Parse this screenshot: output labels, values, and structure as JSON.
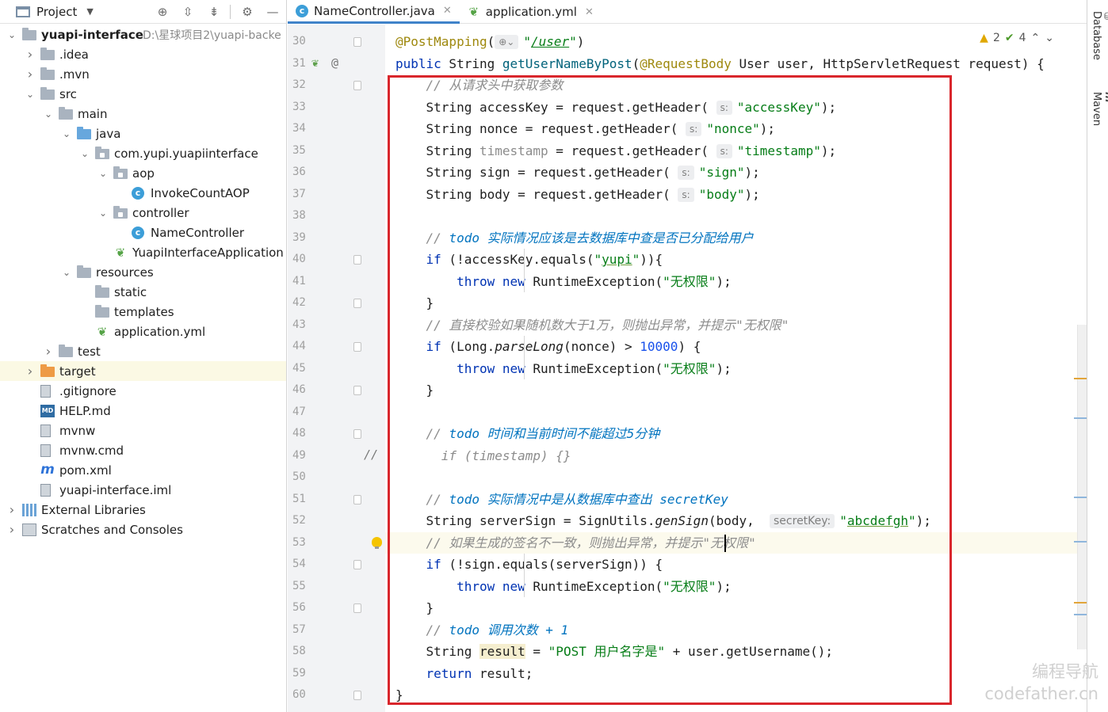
{
  "project_pane": {
    "title": "Project",
    "tree": [
      {
        "label": "yuapi-interface",
        "path": "D:\\星球项目2\\yuapi-backe",
        "indent": 0,
        "chevron": "open",
        "icon": "folder-module-icon"
      },
      {
        "label": ".idea",
        "indent": 1,
        "chevron": "closed",
        "icon": "folder-icon"
      },
      {
        "label": ".mvn",
        "indent": 1,
        "chevron": "closed",
        "icon": "folder-icon"
      },
      {
        "label": "src",
        "indent": 1,
        "chevron": "open",
        "icon": "folder-icon"
      },
      {
        "label": "main",
        "indent": 2,
        "chevron": "open",
        "icon": "folder-icon"
      },
      {
        "label": "java",
        "indent": 3,
        "chevron": "open",
        "icon": "folder-source-icon"
      },
      {
        "label": "com.yupi.yuapiinterface",
        "indent": 4,
        "chevron": "open",
        "icon": "package-icon"
      },
      {
        "label": "aop",
        "indent": 5,
        "chevron": "open",
        "icon": "package-icon"
      },
      {
        "label": "InvokeCountAOP",
        "indent": 6,
        "chevron": "",
        "icon": "class-icon"
      },
      {
        "label": "controller",
        "indent": 5,
        "chevron": "open",
        "icon": "package-icon"
      },
      {
        "label": "NameController",
        "indent": 6,
        "chevron": "",
        "icon": "class-icon"
      },
      {
        "label": "YuapiInterfaceApplication",
        "indent": 5,
        "chevron": "",
        "icon": "spring-boot-class-icon"
      },
      {
        "label": "resources",
        "indent": 3,
        "chevron": "open",
        "icon": "folder-resources-icon"
      },
      {
        "label": "static",
        "indent": 4,
        "chevron": "",
        "icon": "folder-icon"
      },
      {
        "label": "templates",
        "indent": 4,
        "chevron": "",
        "icon": "folder-icon"
      },
      {
        "label": "application.yml",
        "indent": 4,
        "chevron": "",
        "icon": "yaml-file-icon"
      },
      {
        "label": "test",
        "indent": 2,
        "chevron": "closed",
        "icon": "folder-icon"
      },
      {
        "label": "target",
        "indent": 1,
        "chevron": "closed",
        "icon": "folder-excluded-icon",
        "selected": true
      },
      {
        "label": ".gitignore",
        "indent": 1,
        "chevron": "",
        "icon": "gitignore-file-icon"
      },
      {
        "label": "HELP.md",
        "indent": 1,
        "chevron": "",
        "icon": "markdown-file-icon"
      },
      {
        "label": "mvnw",
        "indent": 1,
        "chevron": "",
        "icon": "shell-file-icon"
      },
      {
        "label": "mvnw.cmd",
        "indent": 1,
        "chevron": "",
        "icon": "cmd-file-icon"
      },
      {
        "label": "pom.xml",
        "indent": 1,
        "chevron": "",
        "icon": "maven-file-icon"
      },
      {
        "label": "yuapi-interface.iml",
        "indent": 1,
        "chevron": "",
        "icon": "iml-file-icon"
      },
      {
        "label": "External Libraries",
        "indent": 0,
        "chevron": "closed",
        "icon": "libraries-icon"
      },
      {
        "label": "Scratches and Consoles",
        "indent": 0,
        "chevron": "closed",
        "icon": "scratches-icon"
      }
    ]
  },
  "tabs": [
    {
      "label": "NameController.java",
      "active": true,
      "icon": "java-class-icon"
    },
    {
      "label": "application.yml",
      "active": false,
      "icon": "yaml-file-icon"
    }
  ],
  "right_strip": {
    "database": "Database",
    "maven": "Maven"
  },
  "inspections": {
    "warnings": "2",
    "ok": "4"
  },
  "editor": {
    "lines": [
      {
        "n": "30",
        "html": "<span class=\"ann\">@PostMapping</span>(<span class=\"hint\">⊕⌄</span><span class=\"str\">\"<span class=\"url\">/user</span>\"</span>)"
      },
      {
        "n": "31",
        "html": "<span class=\"kw\">public</span> String <span class=\"fn\">getUserNameByPost</span>(<span class=\"ann\">@RequestBody</span> User user, HttpServletRequest request) {"
      },
      {
        "n": "32",
        "html": "    <span class=\"cmt\">// 从请求头中获取参数</span>"
      },
      {
        "n": "33",
        "html": "    String accessKey = request.getHeader( <span class=\"hint\">s:</span><span class=\"str\">\"accessKey\"</span>);"
      },
      {
        "n": "34",
        "html": "    String nonce = request.getHeader( <span class=\"hint\">s:</span><span class=\"str\">\"nonce\"</span>);"
      },
      {
        "n": "35",
        "html": "    String <span class=\"unused\">timestamp</span> = request.getHeader( <span class=\"hint\">s:</span><span class=\"str\">\"timestamp\"</span>);"
      },
      {
        "n": "36",
        "html": "    String sign = request.getHeader( <span class=\"hint\">s:</span><span class=\"str\">\"sign\"</span>);"
      },
      {
        "n": "37",
        "html": "    String body = request.getHeader( <span class=\"hint\">s:</span><span class=\"str\">\"body\"</span>);"
      },
      {
        "n": "38",
        "html": ""
      },
      {
        "n": "39",
        "html": "    <span class=\"cmt\">// </span><span class=\"todo\">todo</span> <span class=\"todo-txt\">实际情况应该是去数据库中查是否已分配给用户</span>"
      },
      {
        "n": "40",
        "html": "    <span class=\"kw\">if</span> (!accessKey.equals(<span class=\"str\">\"<span class=\"ul\">yupi</span>\"</span>)){"
      },
      {
        "n": "41",
        "html": "        <span class=\"kw\">throw new</span> RuntimeException(<span class=\"str\">\"无权限\"</span>);"
      },
      {
        "n": "42",
        "html": "    }"
      },
      {
        "n": "43",
        "html": "    <span class=\"cmt\">// 直接校验如果随机数大于1万，则抛出异常，并提示\"无权限\"</span>"
      },
      {
        "n": "44",
        "html": "    <span class=\"kw\">if</span> (Long.<span class=\"static-call\">parseLong</span>(nonce) &gt; <span class=\"num\">10000</span>) {"
      },
      {
        "n": "45",
        "html": "        <span class=\"kw\">throw new</span> RuntimeException(<span class=\"str\">\"无权限\"</span>);"
      },
      {
        "n": "46",
        "html": "    }"
      },
      {
        "n": "47",
        "html": ""
      },
      {
        "n": "48",
        "html": "    <span class=\"cmt\">// </span><span class=\"todo\">todo</span> <span class=\"todo-txt\">时间和当前时间不能超过5分钟</span>"
      },
      {
        "n": "49",
        "html": "      <span class=\"cmt\">if (timestamp) {}</span>"
      },
      {
        "n": "50",
        "html": ""
      },
      {
        "n": "51",
        "html": "    <span class=\"cmt\">// </span><span class=\"todo\">todo</span> <span class=\"todo-txt\">实际情况中是从数据库中查出 secretKey</span>"
      },
      {
        "n": "52",
        "html": "    String serverSign = SignUtils.<span class=\"static-call\">genSign</span>(body,  <span class=\"hint long\">secretKey:</span><span class=\"str\">\"<span class=\"ul\">abcdefgh</span>\"</span>);"
      },
      {
        "n": "53",
        "html": "    <span class=\"cmt\">// 如果生成的签名不一致，则抛出异常，并提示\"无权限\"</span>"
      },
      {
        "n": "54",
        "html": "    <span class=\"kw\">if</span> (!sign.equals(serverSign)) {"
      },
      {
        "n": "55",
        "html": "        <span class=\"kw\">throw new</span> RuntimeException(<span class=\"str\">\"无权限\"</span>);"
      },
      {
        "n": "56",
        "html": "    }"
      },
      {
        "n": "57",
        "html": "    <span class=\"cmt\">// </span><span class=\"todo\">todo</span> <span class=\"todo-txt\">调用次数 + 1</span>"
      },
      {
        "n": "58",
        "html": "    String <span class=\"hl-result\">result</span> = <span class=\"str\">\"POST 用户名字是\"</span> + user.getUsername();"
      },
      {
        "n": "59",
        "html": "    <span class=\"kw\">return</span> result;"
      },
      {
        "n": "60",
        "html": "}"
      }
    ],
    "gutter_line_31_marks": "@",
    "gutter_line_49_mark": "//"
  },
  "watermark": {
    "line1": "编程导航",
    "line2": "codefather.cn"
  },
  "colors": {
    "highlight_box": "#d9262c",
    "accent_tab": "#4083c9"
  }
}
